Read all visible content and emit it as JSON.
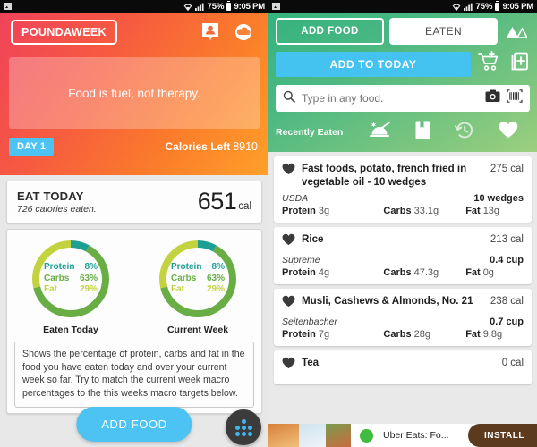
{
  "status_bar": {
    "image_icon": "image-icon",
    "wifi_icon": "wifi-icon",
    "signal_icon": "signal-icon",
    "battery_pct": "75%",
    "battery_icon": "battery-icon",
    "time": "9:05 PM"
  },
  "left": {
    "logo": "POUNDAWEEK",
    "profile_icon": "profile-pin-icon",
    "cloud_icon": "cloud-icon",
    "quote": "Food is fuel, not therapy.",
    "day_badge": "DAY 1",
    "calories_left_label": "Calories Left",
    "calories_left_value": "8910",
    "eat_today": {
      "title": "EAT TODAY",
      "subtitle": "726 calories eaten.",
      "value": "651",
      "unit": "cal"
    },
    "note": "Shows the percentage of protein, carbs and fat in the food you have eaten today and over your current week so far. Try to match the current week macro percentages to the this weeks macro targets below.",
    "add_food_button": "ADD FOOD",
    "dots_fab": "grid-dots-fab"
  },
  "chart_data": [
    {
      "type": "pie",
      "title": "Eaten Today",
      "labels": [
        "Protein",
        "Carbs",
        "Fat"
      ],
      "values": [
        8,
        63,
        29
      ],
      "display": [
        "8%",
        "63%",
        "29%"
      ],
      "colors": [
        "#1e9f94",
        "#69ad45",
        "#c3d33f"
      ],
      "legend": "center",
      "donut": true
    },
    {
      "type": "pie",
      "title": "Current Week",
      "labels": [
        "Protein",
        "Carbs",
        "Fat"
      ],
      "values": [
        8,
        63,
        29
      ],
      "display": [
        "8%",
        "63%",
        "29%"
      ],
      "colors": [
        "#1e9f94",
        "#69ad45",
        "#c3d33f"
      ],
      "legend": "center",
      "donut": true
    }
  ],
  "right": {
    "tab_add_food": "ADD FOOD",
    "tab_eaten": "EATEN",
    "image_icon": "mountain-image-icon",
    "add_to_today": "ADD TO TODAY",
    "cart_icon": "add-to-cart-icon",
    "copy_icon": "add-copy-icon",
    "search_placeholder": "Type in any food.",
    "search_icon": "search-icon",
    "camera_icon": "camera-icon",
    "barcode_icon": "barcode-icon",
    "recently_eaten_label": "Recently Eaten",
    "meal_icon": "meal-dome-icon",
    "book_icon": "bookmark-book-icon",
    "history_icon": "history-clock-icon",
    "favorite_icon": "heart-icon",
    "foods": [
      {
        "name": "Fast foods, potato, french fried in vegetable oil - 10 wedges",
        "calories": "275 cal",
        "brand": "USDA",
        "serving": "10 wedges",
        "protein_label": "Protein",
        "protein": "3g",
        "carbs_label": "Carbs",
        "carbs": "33.1g",
        "fat_label": "Fat",
        "fat": "13g"
      },
      {
        "name": "Rice",
        "calories": "213 cal",
        "brand": "Supreme",
        "serving": "0.4 cup",
        "protein_label": "Protein",
        "protein": "4g",
        "carbs_label": "Carbs",
        "carbs": "47.3g",
        "fat_label": "Fat",
        "fat": "0g"
      },
      {
        "name": "Musli, Cashews & Almonds, No. 21",
        "calories": "238 cal",
        "brand": "Seitenbacher",
        "serving": "0.7 cup",
        "protein_label": "Protein",
        "protein": "7g",
        "carbs_label": "Carbs",
        "carbs": "28g",
        "fat_label": "Fat",
        "fat": "9.8g"
      },
      {
        "name": "Tea",
        "calories": "0 cal",
        "brand": "",
        "serving": "",
        "protein_label": "",
        "protein": "",
        "carbs_label": "",
        "carbs": "",
        "fat_label": "",
        "fat": ""
      }
    ],
    "ad": {
      "title": "Uber Eats: Fo...",
      "install": "INSTALL"
    }
  },
  "colors": {
    "accent_blue": "#4cc3f2",
    "hero_orange": "#fb7e2a",
    "green_header": "#4cb882",
    "protein": "#1e9f94",
    "carbs": "#69ad45",
    "fat": "#c3d33f"
  }
}
